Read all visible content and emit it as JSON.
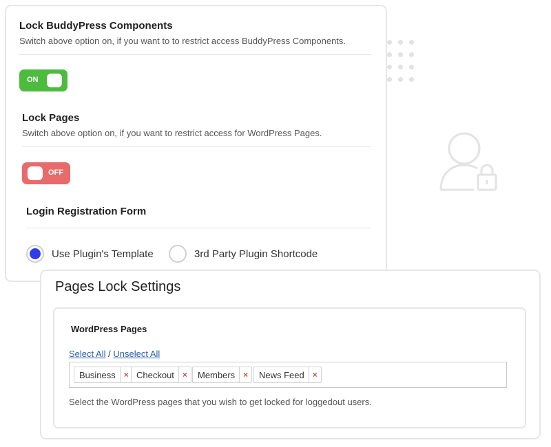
{
  "buddypress": {
    "title": "Lock BuddyPress Components",
    "description": "Switch above option on, if you want to to restrict access BuddyPress Components.",
    "toggle_label": "ON"
  },
  "pages": {
    "title": "Lock Pages",
    "description": "Switch above option on, if you want to restrict access for WordPress Pages.",
    "toggle_label": "OFF"
  },
  "login_form": {
    "title": "Login Registration Form",
    "options": [
      {
        "label": "Use Plugin's Template",
        "selected": true
      },
      {
        "label": "3rd Party Plugin Shortcode",
        "selected": false
      }
    ]
  },
  "pages_lock": {
    "title": "Pages Lock Settings",
    "section_title": "WordPress Pages",
    "select_all": "Select All",
    "separator": "/",
    "unselect_all": "Unselect All",
    "tags": [
      "Business",
      "Checkout",
      "Members",
      "News Feed"
    ],
    "remove_glyph": "×",
    "help": "Select the WordPress pages that you wish to get locked for loggedout users."
  },
  "colors": {
    "toggle_on": "#4cbb3e",
    "toggle_off": "#e86a6a",
    "radio_selected": "#2f3ee9",
    "link": "#2a5db0",
    "remove": "#d94a3a"
  },
  "icons": [
    "user-lock-icon"
  ]
}
